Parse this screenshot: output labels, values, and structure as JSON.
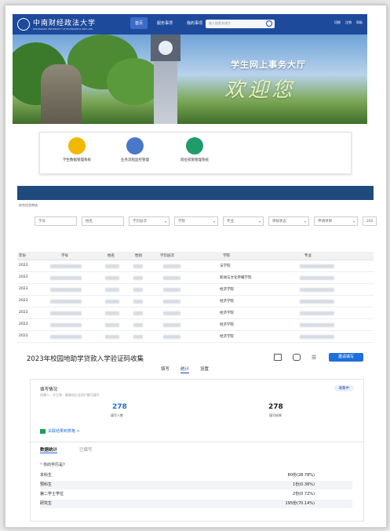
{
  "header": {
    "logo_cn": "中南财经政法大学",
    "logo_en": "ZHONGNAN UNIVERSITY OF ECONOMICS AND LAW",
    "nav": [
      {
        "label": "首页",
        "active": true
      },
      {
        "label": "服务事项",
        "active": false
      },
      {
        "label": "我的事项",
        "active": false
      }
    ],
    "search_placeholder": "输入搜索关键字",
    "right": [
      "切换",
      "注销",
      "帮助"
    ]
  },
  "banner": {
    "title": "学生网上事务大厅",
    "welcome": "欢迎您"
  },
  "systems": [
    {
      "label": "学生数据管理系统",
      "color": "#f2b800",
      "icon": "coin-icon"
    },
    {
      "label": "业务流程监控管理",
      "color": "#4a78c8",
      "icon": "clock-icon"
    },
    {
      "label": "岗位权限管理系统",
      "color": "#1e9c6a",
      "icon": "shield-icon"
    }
  ],
  "breadcrumb": "综合信息审核",
  "filters": [
    {
      "label": "学号",
      "dropdown": false
    },
    {
      "label": "姓名",
      "dropdown": false
    },
    {
      "label": "学历层次",
      "dropdown": true
    },
    {
      "label": "学院",
      "dropdown": true
    },
    {
      "label": "专业",
      "dropdown": true
    },
    {
      "label": "审核状态",
      "dropdown": true
    },
    {
      "label": "申请项目",
      "dropdown": true
    },
    {
      "label": "202",
      "dropdown": false
    }
  ],
  "table": {
    "headers": [
      "年份",
      "学号",
      "姓名",
      "性别",
      "学历层次",
      "学院",
      "专业"
    ],
    "rows": [
      {
        "year": "2023",
        "college": "法学院"
      },
      {
        "year": "2023",
        "college": "新闻与文化传播学院"
      },
      {
        "year": "2023",
        "college": "经济学院"
      },
      {
        "year": "2023",
        "college": "经济学院"
      },
      {
        "year": "2023",
        "college": "经济学院"
      },
      {
        "year": "2023",
        "college": "经济学院"
      },
      {
        "year": "2023",
        "college": "经济学院"
      }
    ]
  },
  "survey": {
    "title": "2023年校园地助学贷款入学验证码收集",
    "tabs": [
      {
        "label": "填写",
        "active": false
      },
      {
        "label": "统计",
        "active": true
      },
      {
        "label": "设置",
        "active": false
      }
    ],
    "button": "邀请填写",
    "status_label": "填写情况",
    "status_sub": "创建人：孙玉琴 · 邀请同企业用户都可填写",
    "badge": "收集中",
    "count_people": "278",
    "count_people_label": "填写人数",
    "count_results": "278",
    "count_results_label": "填写结果",
    "link": "关联结果到表格 >",
    "stat_tabs": [
      {
        "label": "数据统计",
        "active": true
      },
      {
        "label": "已填写",
        "active": false
      }
    ],
    "question": "你的学历是?",
    "options": [
      {
        "label": "本科生",
        "value": "80份(28.78%)"
      },
      {
        "label": "预科生",
        "value": "1份(0.36%)"
      },
      {
        "label": "第二学士学位",
        "value": "2份(0.72%)"
      },
      {
        "label": "研究生",
        "value": "195份(70.14%)"
      }
    ]
  },
  "colors": {
    "brand": "#1e4a9c",
    "accent": "#1e6fd9"
  }
}
